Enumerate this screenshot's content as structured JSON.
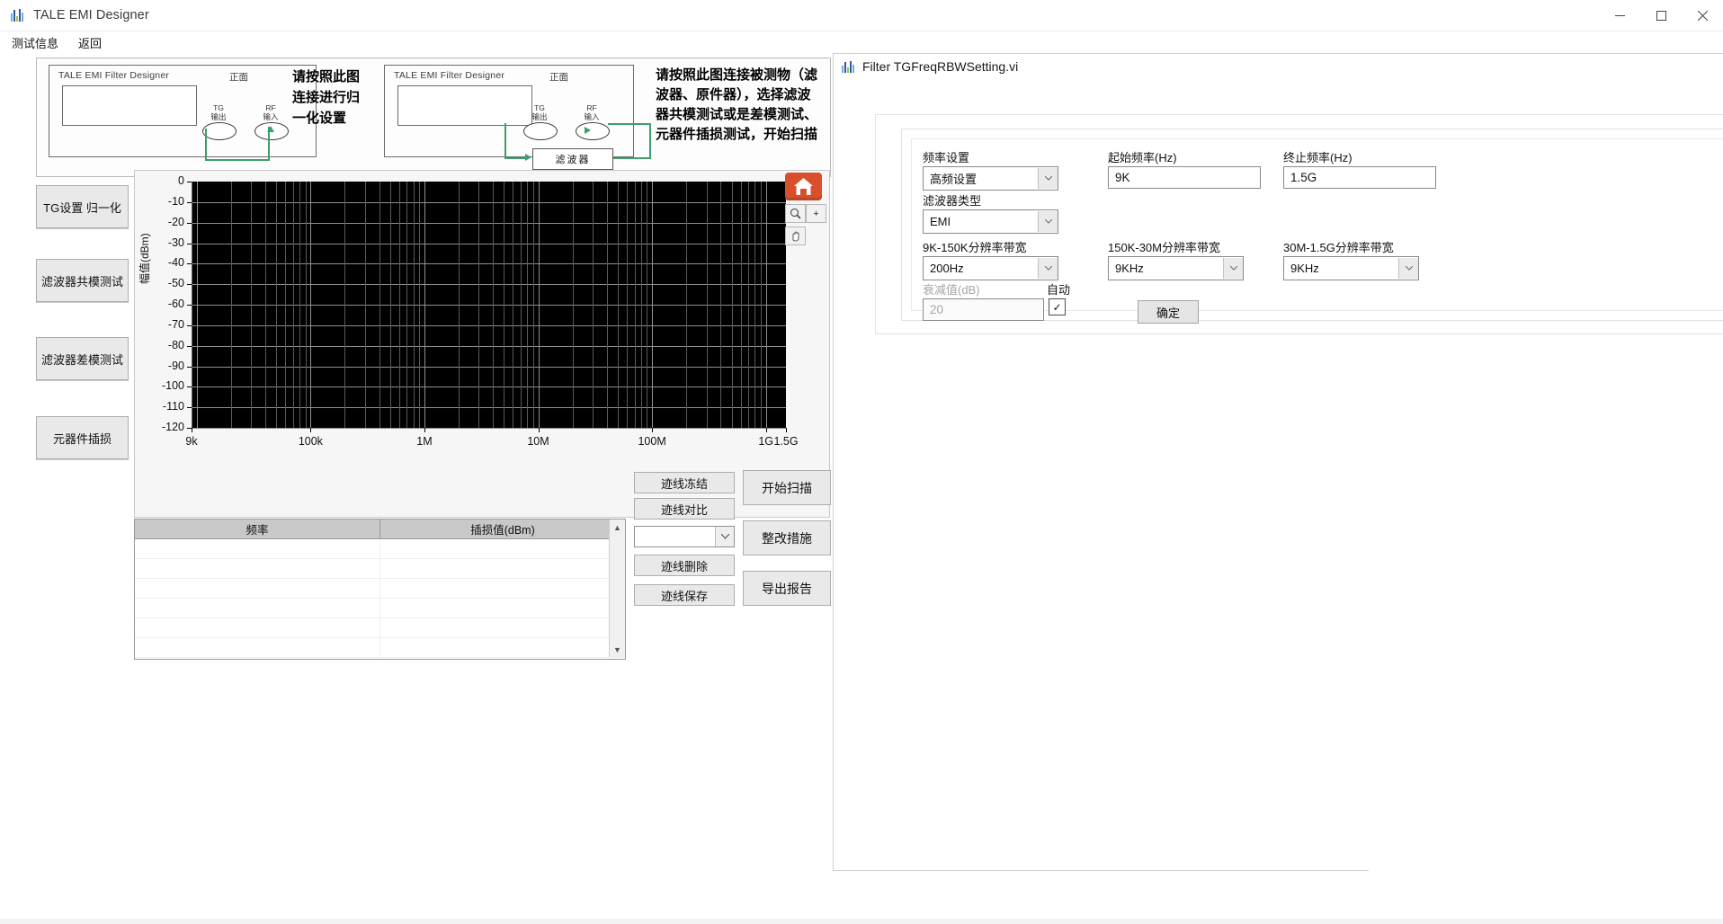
{
  "window": {
    "title": "TALE EMI Designer",
    "icon": "app-bars-icon",
    "minimize": "minimize-icon",
    "maximize": "maximize-icon",
    "close": "close-icon"
  },
  "menu": {
    "items": [
      {
        "label": "测试信息"
      },
      {
        "label": "返回"
      }
    ]
  },
  "diagrams": {
    "left": {
      "device_title": "TALE EMI Filter Designer",
      "device_face": "正面",
      "tg_label_line1": "TG",
      "tg_label_line2": "输出",
      "rf_label_line1": "RF",
      "rf_label_line2": "输入"
    },
    "left_instruction": "请按照此图连接进行归一化设置",
    "right": {
      "device_title": "TALE EMI Filter Designer",
      "device_face": "正面",
      "tg_label_line1": "TG",
      "tg_label_line2": "输出",
      "rf_label_line1": "RF",
      "rf_label_line2": "输入",
      "dut_label": "滤波器"
    },
    "right_instruction": "请按照此图连接被测物（滤波器、原件器），选择滤波器共模测试或是差模测试、元器件插损测试，开始扫描"
  },
  "side_buttons": [
    {
      "label": "TG设置  归一化",
      "name": "tg-normalize-button"
    },
    {
      "label": "滤波器共模测试",
      "name": "filter-common-mode-test-button"
    },
    {
      "label": "滤波器差模测试",
      "name": "filter-differential-mode-test-button"
    },
    {
      "label": "元器件插损",
      "name": "component-insertion-loss-button"
    }
  ],
  "chart_data": {
    "type": "line",
    "title": "",
    "xlabel": "",
    "ylabel": "幅值(dBm)",
    "x_scale": "log",
    "xlim": [
      9000,
      1500000000
    ],
    "ylim": [
      -120,
      0
    ],
    "x_tick_labels": [
      "9k",
      "100k",
      "1M",
      "10M",
      "100M",
      "1G",
      "1.5G"
    ],
    "x_tick_values": [
      9000,
      100000,
      1000000,
      10000000,
      100000000,
      1000000000,
      1500000000
    ],
    "y_tick_labels": [
      "0",
      "-10",
      "-20",
      "-30",
      "-40",
      "-50",
      "-60",
      "-70",
      "-80",
      "-90",
      "-100",
      "-110",
      "-120"
    ],
    "y_tick_values": [
      0,
      -10,
      -20,
      -30,
      -40,
      -50,
      -60,
      -70,
      -80,
      -90,
      -100,
      -110,
      -120
    ],
    "grid": true,
    "plot_background": "#000000",
    "grid_color": "#8f8f8f",
    "series": [
      {
        "name": "插损值(dBm)",
        "x": [],
        "values": []
      }
    ],
    "legend": "none"
  },
  "graph_tools": {
    "home": "home-icon",
    "zoom": "zoom-icon",
    "plus": "plus-icon",
    "pan": "pan-hand-icon"
  },
  "table": {
    "columns": [
      "频率",
      "插损值(dBm)"
    ],
    "rows": [],
    "empty_row_count": 6,
    "scroll_up": "scroll-up-arrow",
    "scroll_down": "scroll-down-arrow"
  },
  "trace_controls": {
    "freeze": "迹线冻结",
    "compare": "迹线对比",
    "select_value": "",
    "delete": "迹线删除",
    "save": "迹线保存"
  },
  "main_actions": {
    "start_scan": "开始扫描",
    "rectify": "整改措施",
    "export_report": "导出报告"
  },
  "dialog": {
    "title": "Filter TGFreqRBWSetting.vi",
    "icon": "vi-bars-icon",
    "fields": {
      "freq_setting_label": "频率设置",
      "freq_setting_value": "高频设置",
      "start_freq_label": "起始频率(Hz)",
      "start_freq_value": "9K",
      "stop_freq_label": "终止频率(Hz)",
      "stop_freq_value": "1.5G",
      "filter_type_label": "滤波器类型",
      "filter_type_value": "EMI",
      "rbw1_label": "9K-150K分辨率带宽",
      "rbw1_value": "200Hz",
      "rbw2_label": "150K-30M分辨率带宽",
      "rbw2_value": "9KHz",
      "rbw3_label": "30M-1.5G分辨率带宽",
      "rbw3_value": "9KHz",
      "atten_label": "衰减值(dB)",
      "atten_value": "20",
      "auto_label": "自动",
      "auto_checked": "✓",
      "confirm": "确定"
    }
  },
  "colors": {
    "accent_orange": "#d94f2b",
    "wire_green": "#3f9e6a",
    "plot_bg": "#000000",
    "button_face": "#e9e9e9"
  }
}
